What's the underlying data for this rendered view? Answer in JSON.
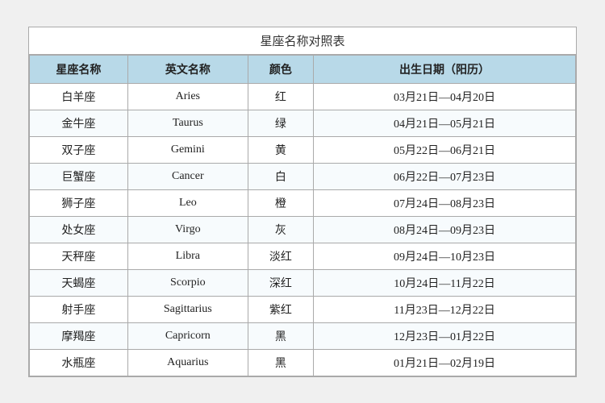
{
  "title": "星座名称对照表",
  "headers": [
    "星座名称",
    "英文名称",
    "颜色",
    "出生日期（阳历）"
  ],
  "rows": [
    {
      "name": "白羊座",
      "en": "Aries",
      "color": "红",
      "date": "03月21日—04月20日"
    },
    {
      "name": "金牛座",
      "en": "Taurus",
      "color": "绿",
      "date": "04月21日—05月21日"
    },
    {
      "name": "双子座",
      "en": "Gemini",
      "color": "黄",
      "date": "05月22日—06月21日"
    },
    {
      "name": "巨蟹座",
      "en": "Cancer",
      "color": "白",
      "date": "06月22日—07月23日"
    },
    {
      "name": "狮子座",
      "en": "Leo",
      "color": "橙",
      "date": "07月24日—08月23日"
    },
    {
      "name": "处女座",
      "en": "Virgo",
      "color": "灰",
      "date": "08月24日—09月23日"
    },
    {
      "name": "天秤座",
      "en": "Libra",
      "color": "淡红",
      "date": "09月24日—10月23日"
    },
    {
      "name": "天蝎座",
      "en": "Scorpio",
      "color": "深红",
      "date": "10月24日—11月22日"
    },
    {
      "name": "射手座",
      "en": "Sagittarius",
      "color": "紫红",
      "date": "11月23日—12月22日"
    },
    {
      "name": "摩羯座",
      "en": "Capricorn",
      "color": "黑",
      "date": "12月23日—01月22日"
    },
    {
      "name": "水瓶座",
      "en": "Aquarius",
      "color": "黑",
      "date": "01月21日—02月19日"
    }
  ]
}
